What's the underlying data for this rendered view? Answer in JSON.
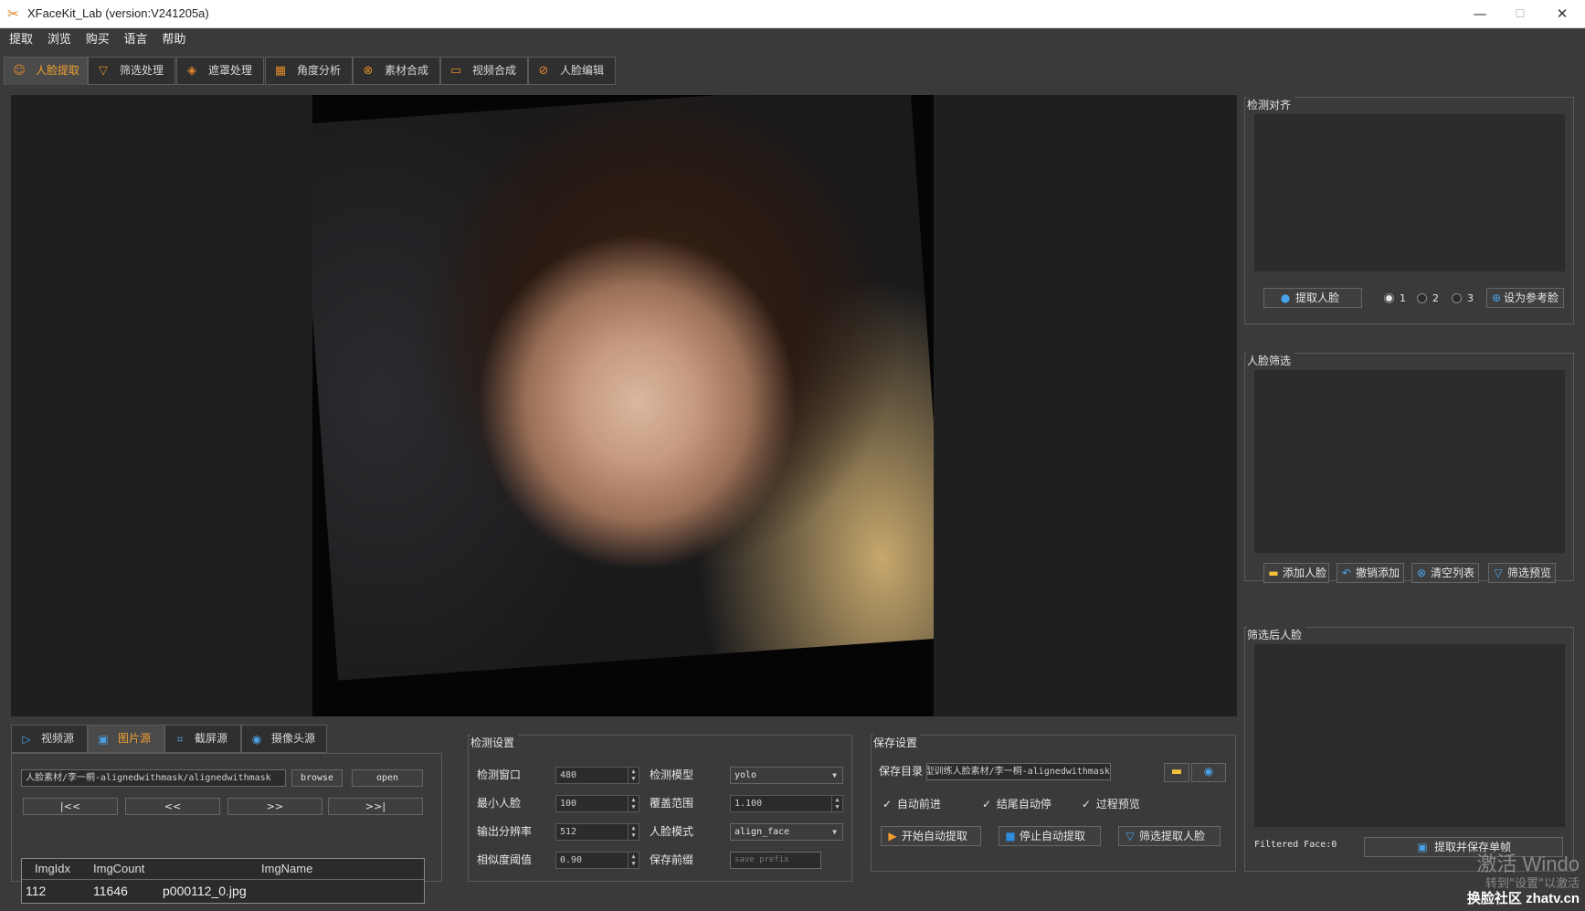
{
  "window": {
    "title": "XFaceKit_Lab (version:V241205a)",
    "controls": {
      "minimize": "—",
      "maximize": "☐",
      "close": "✕"
    }
  },
  "menu": [
    "提取",
    "浏览",
    "购买",
    "语言",
    "帮助"
  ],
  "tabs": [
    {
      "label": "人脸提取",
      "icon": "face-icon",
      "glyph": "☺",
      "active": true
    },
    {
      "label": "筛选处理",
      "icon": "filter-icon",
      "glyph": "▽",
      "active": false
    },
    {
      "label": "遮罩处理",
      "icon": "mask-icon",
      "glyph": "◈",
      "active": false
    },
    {
      "label": "角度分析",
      "icon": "grid-icon",
      "glyph": "▦",
      "active": false
    },
    {
      "label": "素材合成",
      "icon": "merge-icon",
      "glyph": "⊗",
      "active": false
    },
    {
      "label": "视频合成",
      "icon": "film-icon",
      "glyph": "▭",
      "active": false
    },
    {
      "label": "人脸编辑",
      "icon": "edit-icon",
      "glyph": "⊘",
      "active": false
    }
  ],
  "source": {
    "tabs": [
      {
        "label": "视频源",
        "icon": "video-icon",
        "glyph": "▷",
        "active": false
      },
      {
        "label": "图片源",
        "icon": "image-icon",
        "glyph": "▣",
        "active": true
      },
      {
        "label": "截屏源",
        "icon": "crop-icon",
        "glyph": "⌗",
        "active": false
      },
      {
        "label": "摄像头源",
        "icon": "camera-icon",
        "glyph": "◉",
        "active": false
      }
    ],
    "path_value": "人脸素材/李一桐-alignedwithmask/alignedwithmask",
    "browse_label": "browse",
    "open_label": "open",
    "nav": {
      "first": "|<<",
      "prev": "<<",
      "next": ">>",
      "last": ">>|"
    },
    "table": {
      "headers": [
        "ImgIdx",
        "ImgCount",
        "ImgName"
      ],
      "row": [
        "112",
        "11646",
        "p000112_0.jpg"
      ]
    }
  },
  "detect_settings": {
    "title": "检测设置",
    "labels": {
      "window": "检测窗口",
      "model": "检测模型",
      "min_face": "最小人脸",
      "coverage": "覆盖范围",
      "resolution": "输出分辨率",
      "face_mode": "人脸模式",
      "similarity": "相似度阈值",
      "prefix": "保存前缀"
    },
    "values": {
      "window": "480",
      "model": "yolo",
      "min_face": "100",
      "coverage": "1.100",
      "resolution": "512",
      "face_mode": "align_face",
      "similarity": "0.90"
    },
    "prefix_placeholder": "save prefix"
  },
  "save_settings": {
    "title": "保存设置",
    "dir_label": "保存目录",
    "dir_value": "d/模型训练人脸素材/李一桐-alignedwithmask",
    "checks": [
      {
        "label": "自动前进",
        "checked": true
      },
      {
        "label": "结尾自动停",
        "checked": true
      },
      {
        "label": "过程预览",
        "checked": true
      }
    ],
    "buttons": {
      "start": "开始自动提取",
      "stop": "停止自动提取",
      "filter": "筛选提取人脸"
    }
  },
  "align_panel": {
    "title": "检测对齐",
    "extract_btn": "提取人脸",
    "radios": [
      "1",
      "2",
      "3"
    ],
    "set_ref_btn": "设为参考脸"
  },
  "filter_panel": {
    "title": "人脸筛选",
    "buttons": {
      "add": "添加人脸",
      "undo": "撤销添加",
      "clear": "清空列表",
      "preview": "筛选预览"
    }
  },
  "filtered_panel": {
    "title": "筛选后人脸",
    "count_text": "Filtered Face:0",
    "save_btn": "提取并保存单帧"
  },
  "overlay": {
    "activate": "激活 Windo",
    "activate_sub": "转到\"设置\"以激活",
    "site": "换脸社区 zhatv.cn"
  },
  "colors": {
    "accent": "#f0a030",
    "info": "#4aa3e8",
    "background": "#3a3a3a"
  }
}
